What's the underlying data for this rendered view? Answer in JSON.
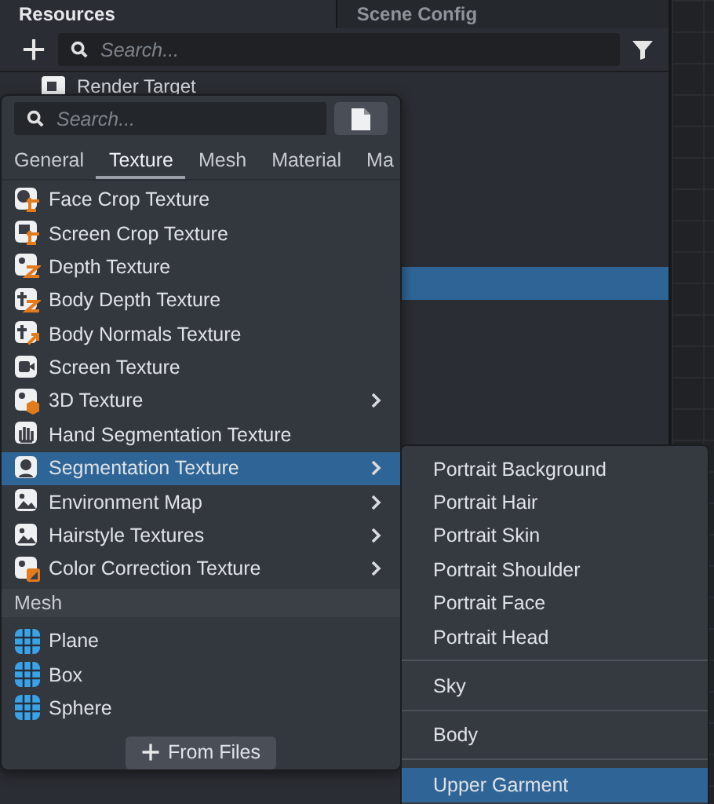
{
  "panel_tabs": [
    {
      "label": "Resources",
      "selected": true
    },
    {
      "label": "Scene Config",
      "selected": false
    }
  ],
  "toolbar": {
    "search": {
      "placeholder": "Search..."
    }
  },
  "resources": [
    {
      "label": "Render Target",
      "selected": false
    },
    {
      "selected": true
    }
  ],
  "menu": {
    "search": {
      "placeholder": "Search..."
    },
    "tabs": [
      {
        "label": "General",
        "selected": false
      },
      {
        "label": "Texture",
        "selected": true
      },
      {
        "label": "Mesh",
        "selected": false
      },
      {
        "label": "Material",
        "selected": false
      },
      {
        "label": "Ma",
        "selected": false
      }
    ],
    "items": [
      {
        "kind": "texture",
        "label": "Face Crop Texture",
        "submenu": false,
        "selected": false
      },
      {
        "kind": "texture",
        "label": "Screen Crop Texture",
        "submenu": false,
        "selected": false
      },
      {
        "kind": "texture",
        "label": "Depth Texture",
        "submenu": false,
        "selected": false
      },
      {
        "kind": "texture",
        "label": "Body Depth Texture",
        "submenu": false,
        "selected": false
      },
      {
        "kind": "texture",
        "label": "Body Normals Texture",
        "submenu": false,
        "selected": false
      },
      {
        "kind": "texture",
        "label": "Screen Texture",
        "submenu": false,
        "selected": false
      },
      {
        "kind": "texture",
        "label": "3D Texture",
        "submenu": true,
        "selected": false
      },
      {
        "kind": "texture",
        "label": "Hand Segmentation Texture",
        "submenu": false,
        "selected": false
      },
      {
        "kind": "texture",
        "label": "Segmentation Texture",
        "submenu": true,
        "selected": true
      },
      {
        "kind": "texture",
        "label": "Environment Map",
        "submenu": true,
        "selected": false
      },
      {
        "kind": "texture",
        "label": "Hairstyle Textures",
        "submenu": true,
        "selected": false
      },
      {
        "kind": "texture",
        "label": "Color Correction Texture",
        "submenu": true,
        "selected": false
      },
      {
        "kind": "header",
        "label": "Mesh"
      },
      {
        "kind": "mesh",
        "label": "Plane",
        "submenu": false,
        "selected": false
      },
      {
        "kind": "mesh",
        "label": "Box",
        "submenu": false,
        "selected": false
      },
      {
        "kind": "mesh",
        "label": "Sphere",
        "submenu": false,
        "selected": false
      }
    ],
    "from_files_button": "From Files"
  },
  "submenu": [
    {
      "kind": "item",
      "label": "Portrait Background",
      "selected": false
    },
    {
      "kind": "item",
      "label": "Portrait Hair",
      "selected": false
    },
    {
      "kind": "item",
      "label": "Portrait Skin",
      "selected": false
    },
    {
      "kind": "item",
      "label": "Portrait Shoulder",
      "selected": false
    },
    {
      "kind": "item",
      "label": "Portrait Face",
      "selected": false
    },
    {
      "kind": "item",
      "label": "Portrait Head",
      "selected": false
    },
    {
      "kind": "separator"
    },
    {
      "kind": "item",
      "label": "Sky",
      "selected": false
    },
    {
      "kind": "separator"
    },
    {
      "kind": "item",
      "label": "Body",
      "selected": false
    },
    {
      "kind": "separator"
    },
    {
      "kind": "item",
      "label": "Upper Garment",
      "selected": true
    }
  ]
}
